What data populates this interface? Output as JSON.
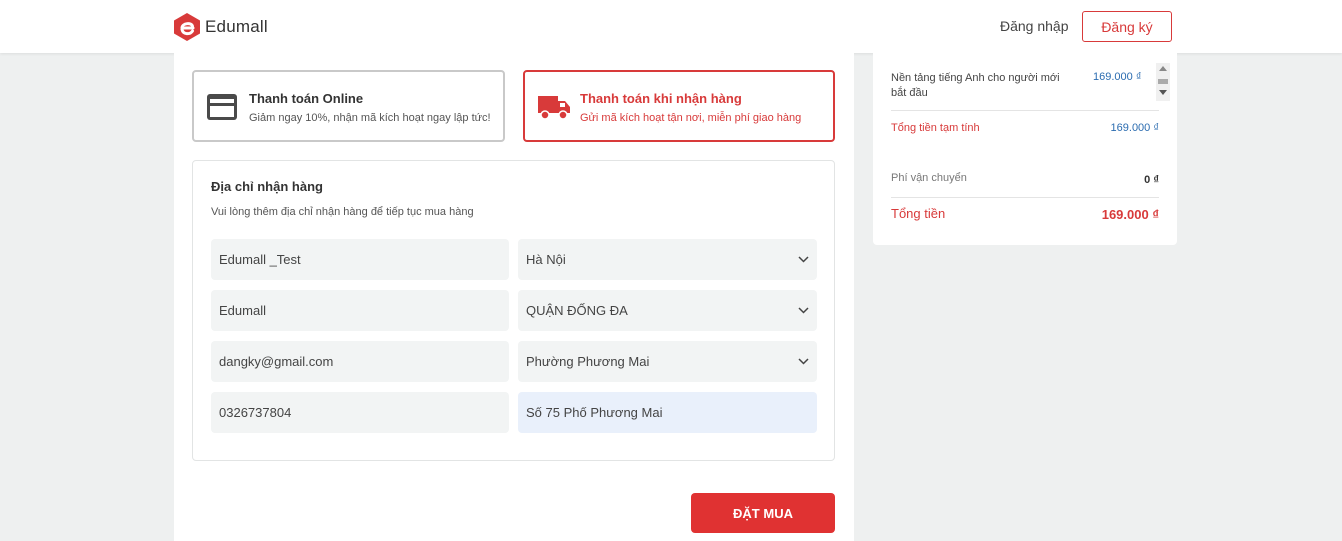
{
  "colors": {
    "brand_red": "#d83a3a",
    "price_blue": "#2b6cb0",
    "button_red": "#e03232"
  },
  "header": {
    "logo_text": "Edumall",
    "login_label": "Đăng nhập",
    "signup_label": "Đăng ký"
  },
  "payment": {
    "online": {
      "title": "Thanh toán Online",
      "subtitle": "Giảm ngay 10%, nhận mã kích hoạt ngay lập tức!",
      "icon": "credit-card-icon",
      "selected": false
    },
    "cod": {
      "title": "Thanh toán khi nhận hàng",
      "subtitle": "Gửi mã kích hoạt tận nơi, miễn phí giao hàng",
      "icon": "truck-icon",
      "selected": true
    }
  },
  "address": {
    "title": "Địa chỉ nhận hàng",
    "note": "Vui lòng thêm địa chỉ nhận hàng để tiếp tục mua hàng",
    "name": "Edumall _Test",
    "city": "Hà Nội",
    "company": "Edumall",
    "district": "QUẬN ĐỐNG ĐA",
    "email": "dangky@gmail.com",
    "ward": "Phường Phương Mai",
    "phone": "0326737804",
    "street": "Số 75 Phố Phương Mai"
  },
  "order_button": "ĐẶT MUA",
  "summary": {
    "item_name": "Nền tảng tiếng Anh cho người mới bắt đầu",
    "item_price": "169.000 ₫",
    "subtotal_label": "Tổng tiền tạm tính",
    "subtotal_value": "169.000 ₫",
    "shipping_label": "Phí vận chuyển",
    "shipping_value": "0 ₫",
    "total_label": "Tổng tiền",
    "total_value": "169.000 ₫"
  }
}
